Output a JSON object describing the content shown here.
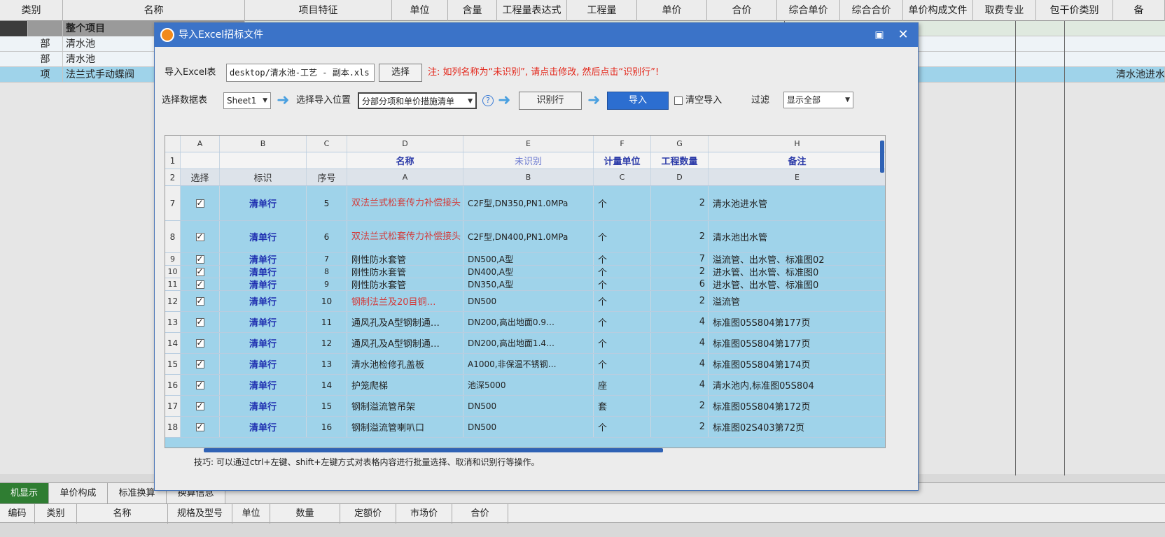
{
  "background": {
    "headers": [
      "类别",
      "名称",
      "项目特征",
      "单位",
      "含量",
      "工程量表达式",
      "工程量",
      "单价",
      "合价",
      "综合单价",
      "综合合价",
      "单价构成文件",
      "取费专业",
      "包干价类别",
      "备"
    ],
    "rows": [
      {
        "type": "",
        "name": "整个项目"
      },
      {
        "type": "部",
        "name": "清水池"
      },
      {
        "type": "部",
        "name": "清水池"
      },
      {
        "type": "项",
        "name": "法兰式手动蝶阀"
      }
    ],
    "right_cell": "清水池进水",
    "bottom_tabs": [
      "机显示",
      "单价构成",
      "标准换算",
      "换算信息"
    ],
    "bottom_headers": [
      "编码",
      "类别",
      "名称",
      "规格及型号",
      "单位",
      "数量",
      "定额价",
      "市场价",
      "合价"
    ]
  },
  "dialog": {
    "title": "导入Excel招标文件",
    "excel_label": "导入Excel表",
    "file_path": "desktop/清水池-工艺 - 副本.xls",
    "choose_button": "选择",
    "note": "注: 如列名称为“未识别”, 请点击修改, 然后点击“识别行”!",
    "sheet_label": "选择数据表",
    "sheet_value": "Sheet1",
    "position_label": "选择导入位置",
    "position_value": "分部分项和单价措施清单",
    "identify_button": "识别行",
    "import_button": "导入",
    "clear_label": "清空导入",
    "filter_label": "过滤",
    "filter_value": "显示全部",
    "tip": "技巧: 可以通过ctrl+左键、shift+左键方式对表格内容进行批量选择、取消和识别行等操作。"
  },
  "grid": {
    "col_letters": [
      "A",
      "B",
      "C",
      "D",
      "E",
      "F",
      "G",
      "H"
    ],
    "row1": {
      "num": "1",
      "cols": [
        "",
        "",
        "",
        "名称",
        "未识别",
        "计量单位",
        "工程数量",
        "备注"
      ]
    },
    "row2": {
      "num": "2",
      "cols": [
        "选择",
        "标识",
        "序号",
        "A",
        "B",
        "C",
        "D",
        "E"
      ]
    },
    "rows": [
      {
        "num": "7",
        "tag": "清单行",
        "seq": "5",
        "name": "双法兰式松套传力补偿接头",
        "spec": "C2F型,DN350,PN1.0MPa",
        "unit": "个",
        "qty": "2",
        "note": "清水池进水管"
      },
      {
        "num": "8",
        "tag": "清单行",
        "seq": "6",
        "name": "双法兰式松套传力补偿接头",
        "spec": "C2F型,DN400,PN1.0MPa",
        "unit": "个",
        "qty": "2",
        "note": "清水池出水管"
      },
      {
        "num": "9",
        "tag": "清单行",
        "seq": "7",
        "name": "刚性防水套管",
        "spec": "DN500,A型",
        "unit": "个",
        "qty": "7",
        "note": "溢流管、出水管、标准图02"
      },
      {
        "num": "10",
        "tag": "清单行",
        "seq": "8",
        "name": "刚性防水套管",
        "spec": "DN400,A型",
        "unit": "个",
        "qty": "2",
        "note": "进水管、出水管、标准图0"
      },
      {
        "num": "11",
        "tag": "清单行",
        "seq": "9",
        "name": "刚性防水套管",
        "spec": "DN350,A型",
        "unit": "个",
        "qty": "6",
        "note": "进水管、出水管、标准图0"
      },
      {
        "num": "12",
        "tag": "清单行",
        "seq": "10",
        "name": "钢制法兰及20目铜…",
        "spec": "DN500",
        "unit": "个",
        "qty": "2",
        "note": "溢流管"
      },
      {
        "num": "13",
        "tag": "清单行",
        "seq": "11",
        "name": "通风孔及A型钢制通…",
        "spec": "DN200,高出地面0.9…",
        "unit": "个",
        "qty": "4",
        "note": "标准图05S804第177页"
      },
      {
        "num": "14",
        "tag": "清单行",
        "seq": "12",
        "name": "通风孔及A型钢制通…",
        "spec": "DN200,高出地面1.4…",
        "unit": "个",
        "qty": "4",
        "note": "标准图05S804第177页"
      },
      {
        "num": "15",
        "tag": "清单行",
        "seq": "13",
        "name": "清水池检修孔盖板",
        "spec": "A1000,非保温不锈钢…",
        "unit": "个",
        "qty": "4",
        "note": "标准图05S804第174页"
      },
      {
        "num": "16",
        "tag": "清单行",
        "seq": "14",
        "name": "护笼爬梯",
        "spec": "池深5000",
        "unit": "座",
        "qty": "4",
        "note": "清水池内,标准图05S804"
      },
      {
        "num": "17",
        "tag": "清单行",
        "seq": "15",
        "name": "钢制溢流管吊架",
        "spec": "DN500",
        "unit": "套",
        "qty": "2",
        "note": "标准图05S804第172页"
      },
      {
        "num": "18",
        "tag": "清单行",
        "seq": "16",
        "name": "钢制溢流管喇叭口",
        "spec": "DN500",
        "unit": "个",
        "qty": "2",
        "note": "标准图02S403第72页"
      }
    ]
  }
}
